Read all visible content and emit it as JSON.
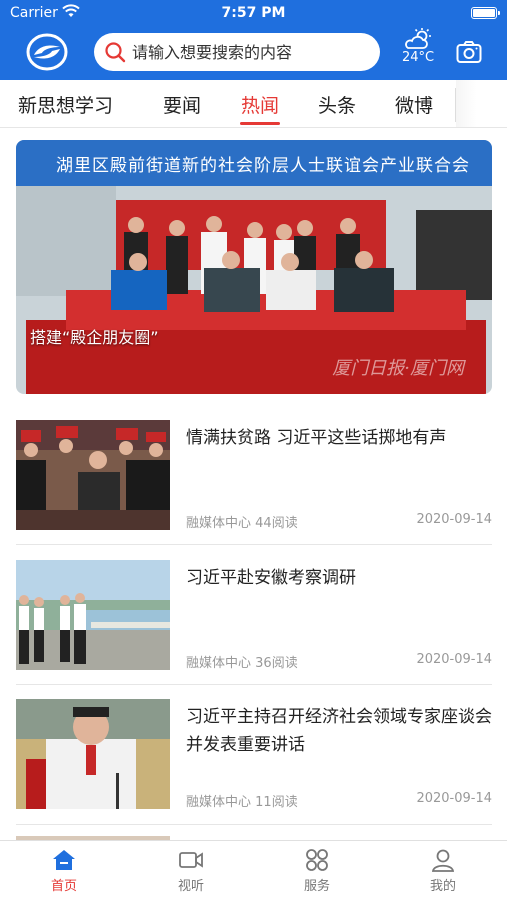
{
  "status_bar": {
    "carrier": "Carrier",
    "time": "7:57 PM"
  },
  "header": {
    "search_placeholder": "请输入想要搜索的内容",
    "weather_temp": "24°C",
    "brand_color": "#1f6fde"
  },
  "tabs": [
    {
      "label": "新思想学习",
      "active": false
    },
    {
      "label": "要闻",
      "active": false
    },
    {
      "label": "热闻",
      "active": true
    },
    {
      "label": "头条",
      "active": false
    },
    {
      "label": "微博",
      "active": false
    }
  ],
  "banner": {
    "caption": "搭建“殿企朋友圈”",
    "sign_text": "湖里区殿前街道新的社会阶层人士联谊会产业联合会",
    "watermark": "厦门日报·厦门网"
  },
  "news": [
    {
      "title": "情满扶贫路 习近平这些话掷地有声",
      "source": "融媒体中心",
      "reads": "44阅读",
      "date": "2020-09-14"
    },
    {
      "title": "习近平赴安徽考察调研",
      "source": "融媒体中心",
      "reads": "36阅读",
      "date": "2020-09-14"
    },
    {
      "title": "习近平主持召开经济社会领域专家座谈会并发表重要讲话",
      "source": "融媒体中心",
      "reads": "11阅读",
      "date": "2020-09-14"
    }
  ],
  "bottom_nav": [
    {
      "label": "首页",
      "icon": "home-icon",
      "active": true
    },
    {
      "label": "视听",
      "icon": "video-icon",
      "active": false
    },
    {
      "label": "服务",
      "icon": "grid-icon",
      "active": false
    },
    {
      "label": "我的",
      "icon": "user-icon",
      "active": false
    }
  ],
  "colors": {
    "accent": "#e53935",
    "header": "#1f6fde"
  }
}
